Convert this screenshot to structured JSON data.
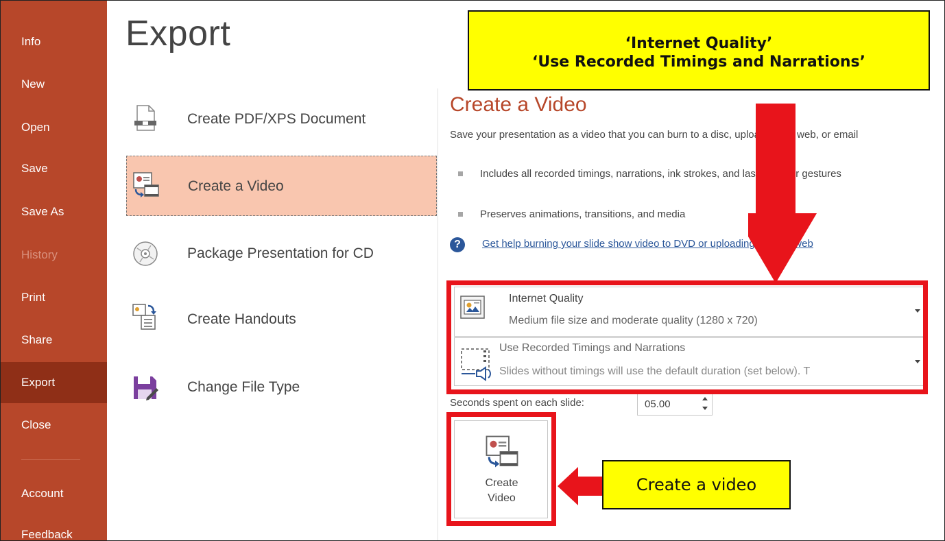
{
  "sidebar": {
    "items": [
      {
        "label": "Info",
        "state": "normal"
      },
      {
        "label": "New",
        "state": "normal"
      },
      {
        "label": "Open",
        "state": "normal"
      },
      {
        "label": "Save",
        "state": "normal"
      },
      {
        "label": "Save As",
        "state": "normal"
      },
      {
        "label": "History",
        "state": "disabled"
      },
      {
        "label": "Print",
        "state": "normal"
      },
      {
        "label": "Share",
        "state": "normal"
      },
      {
        "label": "Export",
        "state": "active"
      },
      {
        "label": "Close",
        "state": "normal"
      },
      {
        "label": "Account",
        "state": "normal"
      },
      {
        "label": "Feedback",
        "state": "normal"
      }
    ],
    "colors": {
      "background": "#b7472a",
      "active": "#8f2f17"
    }
  },
  "page": {
    "title": "Export"
  },
  "export_options": [
    {
      "label": "Create PDF/XPS Document",
      "icon": "pdf-document-icon"
    },
    {
      "label": "Create a Video",
      "icon": "video-icon",
      "selected": true
    },
    {
      "label": "Package Presentation for CD",
      "icon": "cd-icon"
    },
    {
      "label": "Create Handouts",
      "icon": "handouts-icon"
    },
    {
      "label": "Change File Type",
      "icon": "save-file-type-icon"
    }
  ],
  "video_pane": {
    "title": "Create a Video",
    "description": "Save your presentation as a video that you can burn to a disc, upload to the web, or email",
    "bullets": [
      "Includes all recorded timings, narrations, ink strokes, and laser pointer gestures",
      "Preserves animations, transitions, and media"
    ],
    "help_link": "Get help burning your slide show video to DVD or uploading it to the web",
    "quality_dropdown": {
      "title": "Internet Quality",
      "subtitle": "Medium file size and moderate quality (1280 x 720)"
    },
    "timings_dropdown": {
      "title": "Use Recorded Timings and Narrations",
      "subtitle": "Slides without timings will use the default duration (set below). T"
    },
    "seconds_label": "Seconds spent on each slide:",
    "seconds_value": "05.00",
    "create_button": {
      "line1": "Create",
      "line2": "Video"
    }
  },
  "annotations": {
    "top_callout": {
      "line1": "‘Internet Quality’",
      "line2": "‘Use Recorded Timings and Narrations’"
    },
    "bottom_callout": "Create a video",
    "highlight_color": "#e8141b",
    "callout_color": "#ffff00"
  }
}
